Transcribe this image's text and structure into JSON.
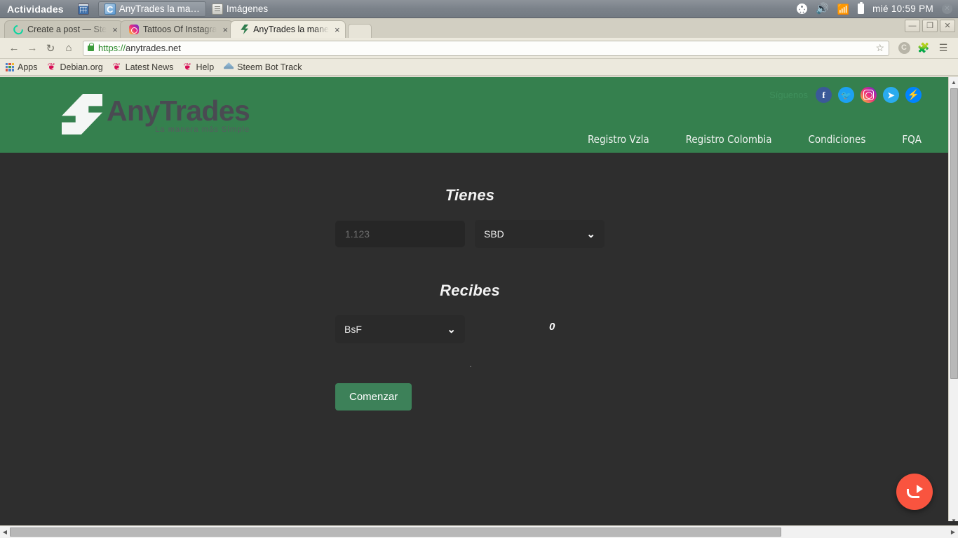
{
  "os_bar": {
    "activities": "Actividades",
    "windows": [
      {
        "name": "calculator-window",
        "label": "",
        "icon": "calculator-icon",
        "active": false
      },
      {
        "name": "anytrades-window",
        "label": "AnyTrades la ma…",
        "icon": "chrome-icon",
        "active": true
      },
      {
        "name": "imagenes-window",
        "label": "Imágenes",
        "icon": "files-icon",
        "active": false
      }
    ],
    "clock": "mié 10:59 PM",
    "icons": [
      "accessibility-icon",
      "volume-icon",
      "wifi-icon",
      "battery-icon",
      "power-icon"
    ]
  },
  "browser": {
    "tabs": [
      {
        "title": "Create a post — Ste",
        "favicon": "steemit-icon",
        "active": false,
        "close": "×"
      },
      {
        "title": "Tattoos Of Instagra",
        "favicon": "instagram-icon",
        "active": false,
        "close": "×"
      },
      {
        "title": "AnyTrades la mane",
        "favicon": "anytrades-icon",
        "active": true,
        "close": "×"
      }
    ],
    "window_controls": {
      "minimize": "—",
      "restore": "❐",
      "close": "✕"
    },
    "nav": {
      "back": "←",
      "forward": "→",
      "reload": "↻",
      "home": "⌂"
    },
    "omnibox": {
      "scheme": "https://",
      "host": "anytrades.net",
      "full_url": "https://anytrades.net",
      "secure": true,
      "star": "☆"
    },
    "toolbar_icons": [
      "colorzilla-icon",
      "extension-puzzle-icon",
      "chrome-menu-icon"
    ],
    "bookmarks": [
      {
        "label": "Apps",
        "icon": "apps-grid-icon"
      },
      {
        "label": "Debian.org",
        "icon": "debian-icon"
      },
      {
        "label": "Latest News",
        "icon": "debian-icon"
      },
      {
        "label": "Help",
        "icon": "debian-icon"
      },
      {
        "label": "Steem Bot Track",
        "icon": "steem-bot-icon"
      }
    ]
  },
  "site": {
    "logo": {
      "name": "AnyTrades",
      "tagline": "La manera más Simple"
    },
    "follow_label": "Síguenos",
    "social": [
      {
        "name": "facebook",
        "glyph": "f",
        "color": "#3b5998"
      },
      {
        "name": "twitter",
        "glyph": "🐦",
        "color": "#1da1f2"
      },
      {
        "name": "instagram",
        "glyph": "",
        "color": "#ee2a7b"
      },
      {
        "name": "telegram",
        "glyph": "➤",
        "color": "#2aabee"
      },
      {
        "name": "messenger",
        "glyph": "⚡",
        "color": "#0084ff"
      }
    ],
    "nav": [
      {
        "label": "Registro Vzla"
      },
      {
        "label": "Registro Colombia"
      },
      {
        "label": "Condiciones"
      },
      {
        "label": "FQA"
      }
    ],
    "colors": {
      "header_green": "#35804e",
      "body_dark": "#2e2e2e",
      "button_green": "#3d8159",
      "fab_red": "#f9543f"
    }
  },
  "form": {
    "have_title": "Tienes",
    "amount_placeholder": "1.123",
    "amount_value": "",
    "have_currency": "SBD",
    "receive_title": "Recibes",
    "receive_currency": "BsF",
    "receive_value": "0",
    "separator": ".",
    "caret": "❯",
    "submit_label": "Comenzar"
  },
  "fab": {
    "name": "share-fab",
    "icon": "share-arrow-icon"
  }
}
